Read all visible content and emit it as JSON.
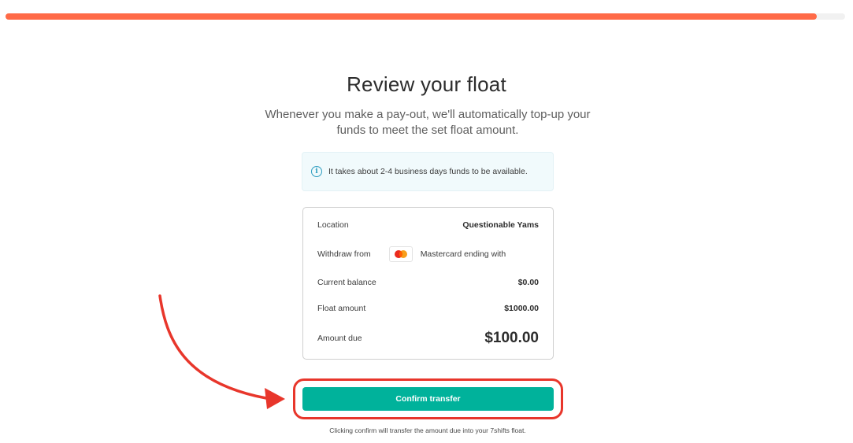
{
  "progress": {
    "value_percent": 96.6,
    "color": "#ff6a47"
  },
  "header": {
    "title": "Review your float",
    "subtitle": "Whenever you make a pay-out, we'll automatically top-up your funds to meet the set float amount."
  },
  "info_banner": {
    "icon": "info-icon",
    "text": "It takes about 2-4 business days funds to be available."
  },
  "summary": {
    "location": {
      "label": "Location",
      "value": "Questionable Yams"
    },
    "withdraw_from": {
      "label": "Withdraw from",
      "card_icon": "mastercard-icon",
      "value": "Mastercard ending with"
    },
    "current_balance": {
      "label": "Current balance",
      "value": "$0.00"
    },
    "float_amount": {
      "label": "Float amount",
      "value": "$1000.00"
    },
    "amount_due": {
      "label": "Amount due",
      "value": "$100.00"
    }
  },
  "actions": {
    "confirm_label": "Confirm transfer",
    "confirm_color": "#00b29b"
  },
  "footnote": "Clicking confirm will transfer the amount due into your 7shifts float.",
  "annotation": {
    "highlight_color": "#e8362b"
  }
}
